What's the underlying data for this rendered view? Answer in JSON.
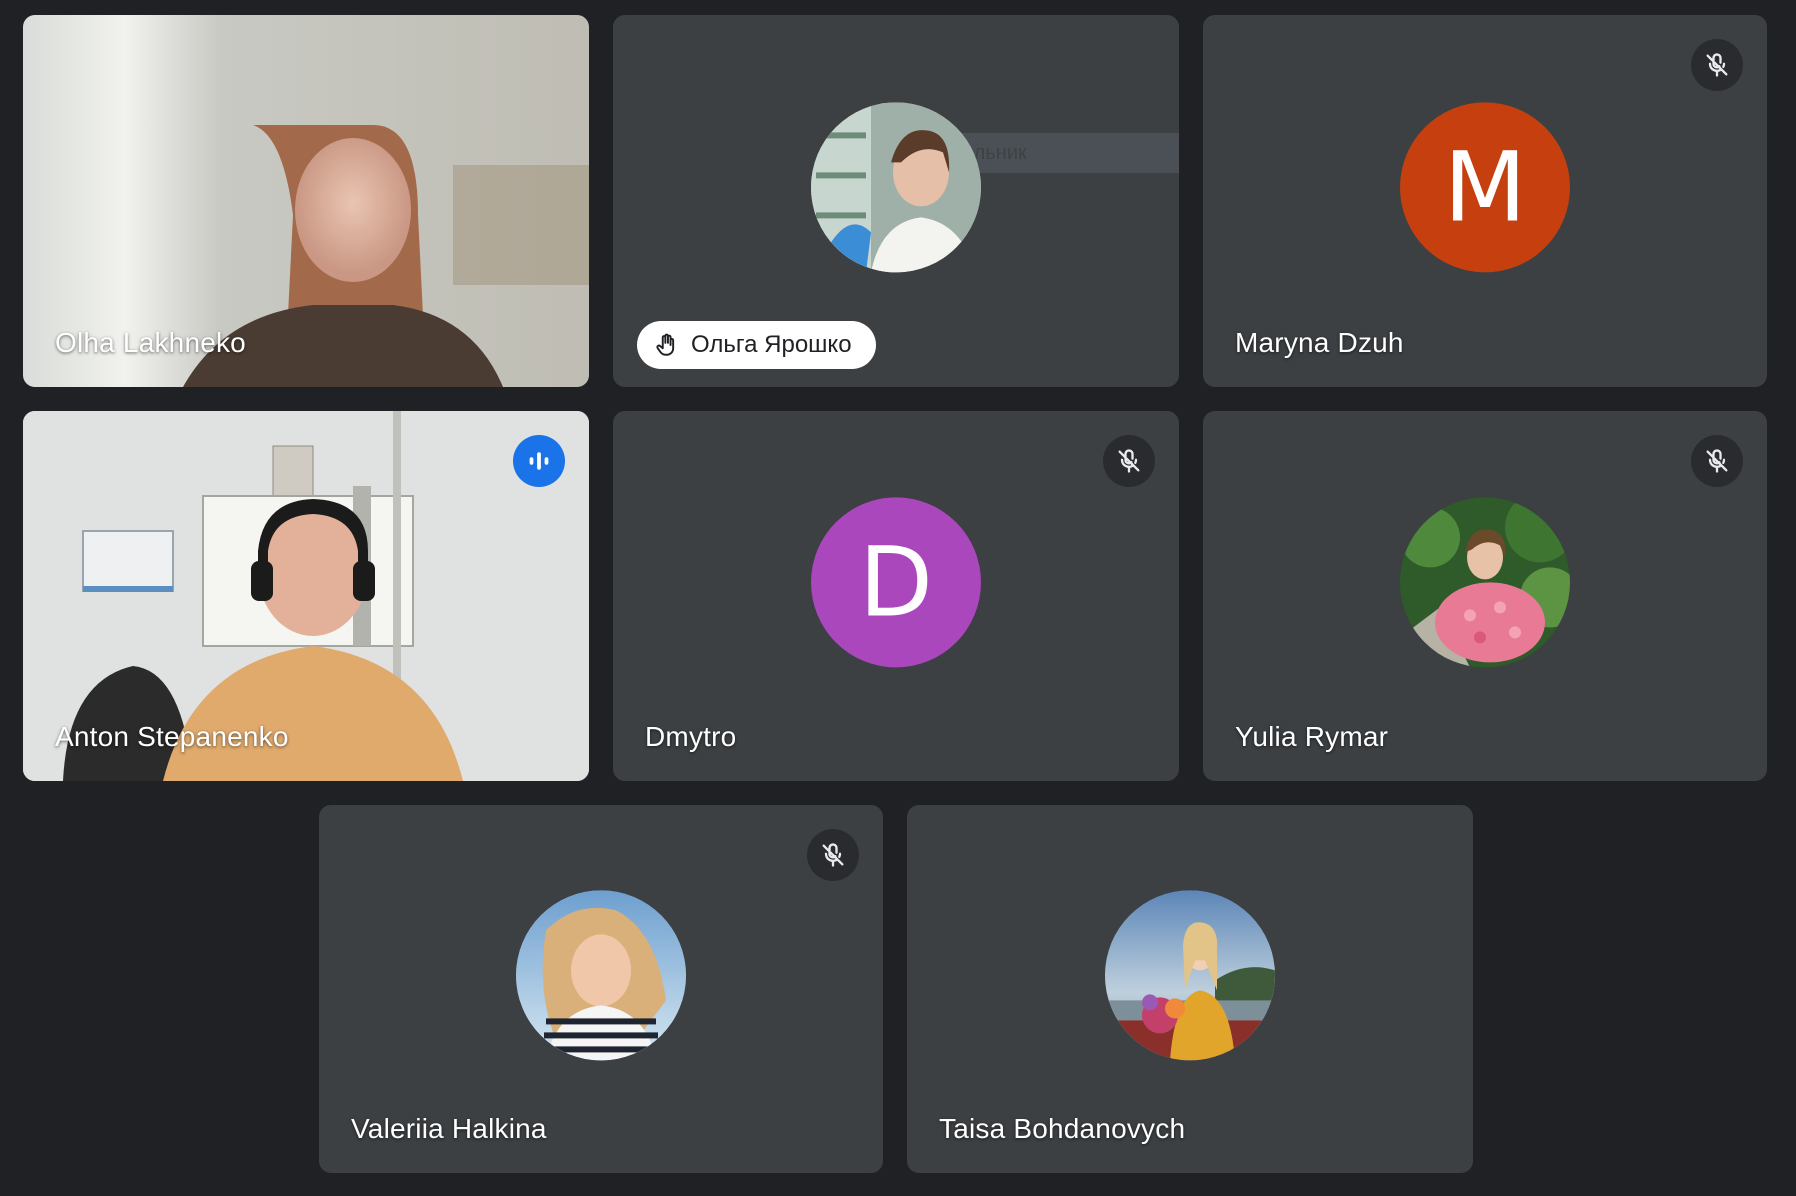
{
  "participants": [
    {
      "name": "Olha Lakhneko",
      "type": "video"
    },
    {
      "name": "Ольга Ярошко",
      "type": "photo",
      "raised_hand": true,
      "overlay_text": "ольник"
    },
    {
      "name": "Maryna Dzuh",
      "type": "initial",
      "initial": "M",
      "color": "#c5400e",
      "muted": true
    },
    {
      "name": "Anton Stepanenko",
      "type": "video",
      "speaking": true
    },
    {
      "name": "Dmytro",
      "type": "initial",
      "initial": "D",
      "color": "#ab47bc",
      "muted": true
    },
    {
      "name": "Yulia Rymar",
      "type": "photo",
      "muted": true
    },
    {
      "name": "Valeriia Halkina",
      "type": "photo",
      "muted": true
    },
    {
      "name": "Taisa Bohdanovych",
      "type": "photo"
    }
  ],
  "icons": {
    "mute": "mic-off-icon",
    "speaking": "audio-level-icon",
    "raised_hand": "hand-icon"
  },
  "colors": {
    "background": "#202124",
    "tile": "#3c4043",
    "active_outline": "#8ab4f8",
    "speaking_badge": "#1a73e8"
  }
}
